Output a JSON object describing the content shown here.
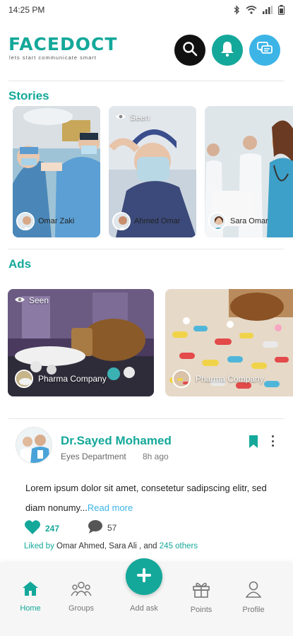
{
  "status_bar": {
    "time": "14:25 PM"
  },
  "header": {
    "brand": "FACEDOCT",
    "tagline": "lets start communicate smart",
    "colors": {
      "primary": "#14a89a",
      "chat": "#3cb4e6",
      "search": "#111111"
    }
  },
  "stories": {
    "title": "Stories",
    "items": [
      {
        "name": "Omar Zaki",
        "seen_label": ""
      },
      {
        "name": "Ahmed Omar",
        "seen_label": "Seen"
      },
      {
        "name": "Sara Omar",
        "seen_label": ""
      }
    ]
  },
  "ads": {
    "title": "Ads",
    "items": [
      {
        "company": "Pharma Company",
        "seen_label": "Seen"
      },
      {
        "company": "Pharma Company",
        "seen_label": ""
      }
    ]
  },
  "post": {
    "author": "Dr.Sayed Mohamed",
    "department": "Eyes Department",
    "time": "8h ago",
    "text": "Lorem ipsum dolor sit amet, consetetur sadipscing elitr, sed diam nonumy...",
    "read_more": "Read more",
    "likes": "247",
    "comments": "57",
    "liked_by_prefix": "Liked by",
    "liked_by_names": " Omar Ahmed, Sara Ali , and ",
    "liked_by_others": "245 others"
  },
  "nav": {
    "home": "Home",
    "groups": "Groups",
    "add": "Add ask",
    "points": "Points",
    "profile": "Profile"
  }
}
